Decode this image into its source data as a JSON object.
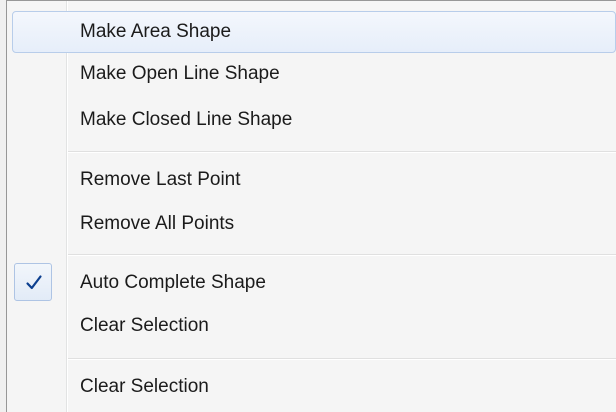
{
  "menu": {
    "items": [
      {
        "label": "Make Area Shape",
        "checked": false,
        "hovered": true
      },
      {
        "label": "Make Open Line Shape",
        "checked": false,
        "hovered": false
      },
      {
        "label": "Make Closed Line Shape",
        "checked": false,
        "hovered": false
      },
      {
        "label": "Remove Last Point",
        "checked": false,
        "hovered": false
      },
      {
        "label": "Remove All Points",
        "checked": false,
        "hovered": false
      },
      {
        "label": "Auto Complete Shape",
        "checked": true,
        "hovered": false
      },
      {
        "label": "Clear Selection",
        "checked": false,
        "hovered": false
      },
      {
        "label": "Clear Selection",
        "checked": false,
        "hovered": false
      }
    ]
  },
  "colors": {
    "hover_border": "#b8cdea",
    "check_mark": "#0c3f8f",
    "text": "#1b1b1b"
  },
  "icons": {
    "check": "check-icon"
  }
}
